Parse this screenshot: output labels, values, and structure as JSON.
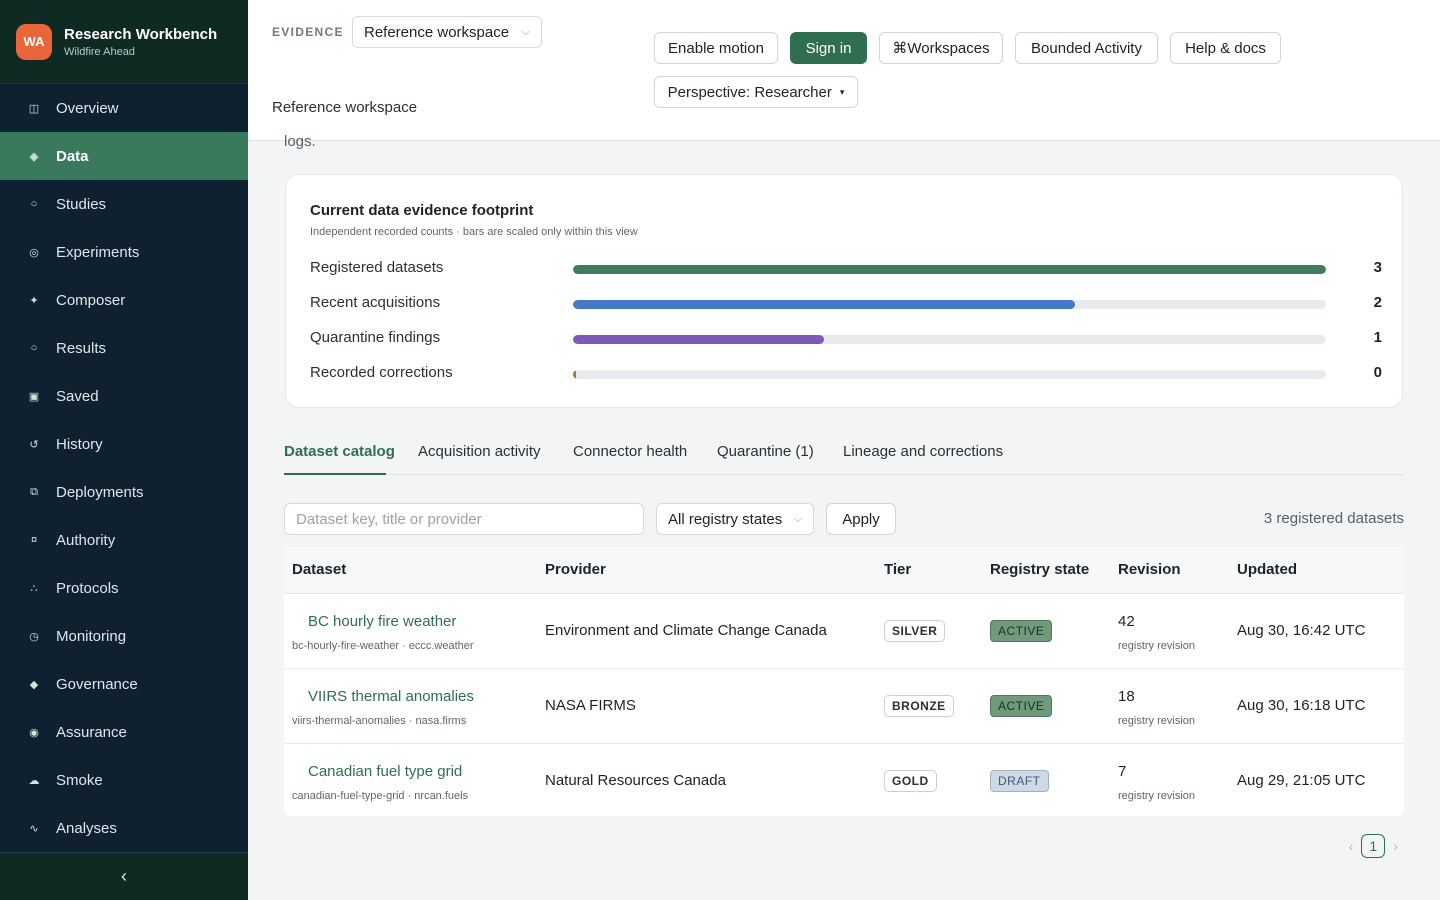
{
  "brand": {
    "initials": "WA",
    "title": "Research Workbench",
    "subtitle": "Wildfire Ahead"
  },
  "nav": [
    {
      "label": "Overview",
      "icon": "grid-icon",
      "glyph": "◫"
    },
    {
      "label": "Data",
      "icon": "diamond-icon",
      "glyph": "◈",
      "active": true
    },
    {
      "label": "Studies",
      "icon": "circle-icon",
      "glyph": "○"
    },
    {
      "label": "Experiments",
      "icon": "target-icon",
      "glyph": "◎"
    },
    {
      "label": "Composer",
      "icon": "sparkle-icon",
      "glyph": "✦"
    },
    {
      "label": "Results",
      "icon": "dot-icon",
      "glyph": "○"
    },
    {
      "label": "Saved",
      "icon": "square-icon",
      "glyph": "▣"
    },
    {
      "label": "History",
      "icon": "history-icon",
      "glyph": "↺"
    },
    {
      "label": "Deployments",
      "icon": "stack-icon",
      "glyph": "⧉"
    },
    {
      "label": "Authority",
      "icon": "lock-icon",
      "glyph": "¤"
    },
    {
      "label": "Protocols",
      "icon": "nodes-icon",
      "glyph": "∴"
    },
    {
      "label": "Monitoring",
      "icon": "gauge-icon",
      "glyph": "◷"
    },
    {
      "label": "Governance",
      "icon": "rhombus-icon",
      "glyph": "◆"
    },
    {
      "label": "Assurance",
      "icon": "badge-icon",
      "glyph": "◉"
    },
    {
      "label": "Smoke",
      "icon": "cloud-icon",
      "glyph": "☁"
    },
    {
      "label": "Analyses",
      "icon": "wave-icon",
      "glyph": "∿"
    }
  ],
  "collapse_glyph": "‹",
  "topbar": {
    "evidence_label": "EVIDENCE",
    "workspace_select": "Reference workspace",
    "workspace_name": "Reference workspace",
    "buttons": {
      "motion": "Enable motion",
      "signin": "Sign in",
      "workspaces": "⌘Workspaces",
      "bounded": "Bounded Activity",
      "help": "Help & docs",
      "perspective": "Perspective: Researcher"
    },
    "perspective_caret": "▾",
    "select_caret": "⌵"
  },
  "under_text": "logs.",
  "footprint": {
    "title": "Current data evidence footprint",
    "subtitle": "Independent recorded counts · bars are scaled only within this view",
    "rows": [
      {
        "label": "Registered datasets",
        "value": 3,
        "fraction": 1.0,
        "color": "#3f7c5e"
      },
      {
        "label": "Recent acquisitions",
        "value": 2,
        "fraction": 0.667,
        "color": "#4577c7"
      },
      {
        "label": "Quarantine findings",
        "value": 1,
        "fraction": 0.333,
        "color": "#7c5ab8"
      },
      {
        "label": "Recorded corrections",
        "value": 0,
        "fraction": 0.0,
        "color": "#a07a3c"
      }
    ]
  },
  "tabs": [
    "Dataset catalog",
    "Acquisition activity",
    "Connector health",
    "Quarantine (1)",
    "Lineage and corrections"
  ],
  "filters": {
    "search_placeholder": "Dataset key, title or provider",
    "state_select": "All registry states",
    "apply": "Apply",
    "count_text": "3 registered datasets"
  },
  "table": {
    "headers": [
      "Dataset",
      "Provider",
      "Tier",
      "Registry state",
      "Revision",
      "Updated"
    ],
    "rows": [
      {
        "title": "BC hourly fire weather",
        "key": "bc-hourly-fire-weather · eccc.weather",
        "provider": "Environment and Climate Change Canada",
        "tier": "SILVER",
        "state": "ACTIVE",
        "revision": "42",
        "revision_sub": "registry revision",
        "updated": "Aug 30, 16:42 UTC"
      },
      {
        "title": "VIIRS thermal anomalies",
        "key": "viirs-thermal-anomalies · nasa.firms",
        "provider": "NASA FIRMS",
        "tier": "BRONZE",
        "state": "ACTIVE",
        "revision": "18",
        "revision_sub": "registry revision",
        "updated": "Aug 30, 16:18 UTC"
      },
      {
        "title": "Canadian fuel type grid",
        "key": "canadian-fuel-type-grid · nrcan.fuels",
        "provider": "Natural Resources Canada",
        "tier": "GOLD",
        "state": "DRAFT",
        "revision": "7",
        "revision_sub": "registry revision",
        "updated": "Aug 29, 21:05 UTC"
      }
    ]
  },
  "pager": {
    "prev": "‹",
    "page": "1",
    "next": "›"
  }
}
